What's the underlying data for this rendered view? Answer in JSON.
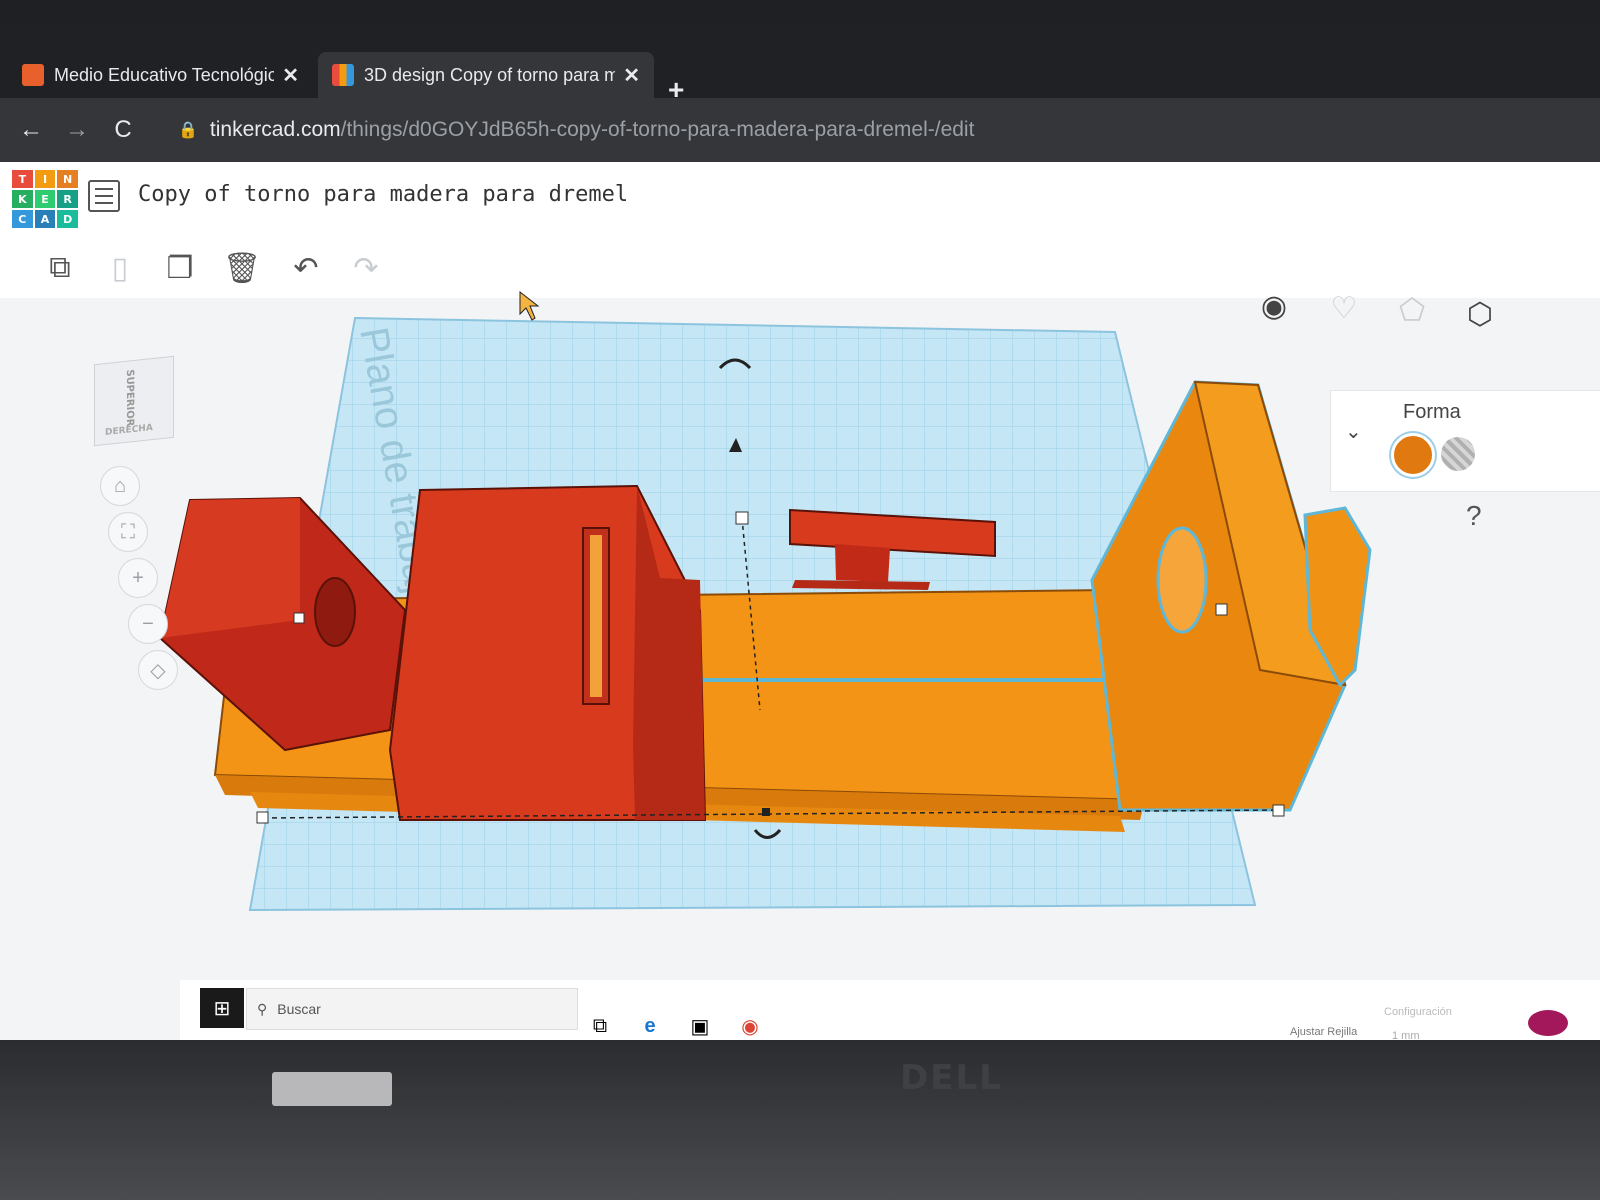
{
  "browser": {
    "tabs": [
      {
        "title": "Medio Educativo Tecnológico pa",
        "active": false
      },
      {
        "title": "3D design Copy of torno para m",
        "active": true
      }
    ],
    "close_symbol": "✕",
    "new_tab_symbol": "+",
    "back_icon": "←",
    "forward_icon": "→",
    "reload_icon": "C",
    "url_domain": "tinkercad.com",
    "url_path": "/things/d0GOYJdB65h-copy-of-torno-para-madera-para-dremel-/edit"
  },
  "app": {
    "logo_letters": [
      "T",
      "I",
      "N",
      "K",
      "E",
      "R",
      "C",
      "A",
      "D"
    ],
    "logo_colors": [
      "#e74c3c",
      "#f39c12",
      "#e67e22",
      "#27ae60",
      "#2ecc71",
      "#16a085",
      "#3498db",
      "#2980b9",
      "#1abc9c"
    ],
    "design_title": "Copy of torno para madera para dremel"
  },
  "toolbar": {
    "copy_icon": "⧉",
    "paste_icon": "▯",
    "duplicate_icon": "❐",
    "delete_icon": "🗑",
    "undo_icon": "↶",
    "redo_icon": "↷"
  },
  "view_cube": {
    "top_label": "SUPERIOR",
    "front_label": "DERECHA"
  },
  "side_controls": {
    "home": "⌂",
    "fit": "⛶",
    "zoom_in": "+",
    "zoom_out": "−",
    "perspective": "◇"
  },
  "right_tools": {
    "notes": "◉",
    "light": "♡",
    "shape_outline": "⬠",
    "shape_group": "⬡"
  },
  "workplane": {
    "label": "Plano de trabajo"
  },
  "shape_panel": {
    "title": "Forma",
    "chevron": "⌄",
    "solid_color": "#e07a10",
    "help": "?"
  },
  "taskbar": {
    "start_icon": "⊞",
    "search_icon": "⚲",
    "search_placeholder": "Buscar",
    "icons": [
      {
        "name": "task-view-icon",
        "glyph": "⧉",
        "color": "#222"
      },
      {
        "name": "edge-icon",
        "glyph": "e",
        "color": "#1976d2"
      },
      {
        "name": "store-icon",
        "glyph": "▣",
        "color": "#555"
      },
      {
        "name": "chrome-icon",
        "glyph": "◉",
        "color": "#db4437"
      }
    ]
  },
  "settings": {
    "config_label": "Configuración",
    "grid_label": "Ajustar Rejilla",
    "grid_value": "1 mm"
  },
  "hardware": {
    "brand": "DELL"
  },
  "colors": {
    "red_shape": "#d83a1e",
    "orange_shape": "#f09214",
    "workplane": "#bfe3f3",
    "grid_line": "#9ccfe6"
  }
}
